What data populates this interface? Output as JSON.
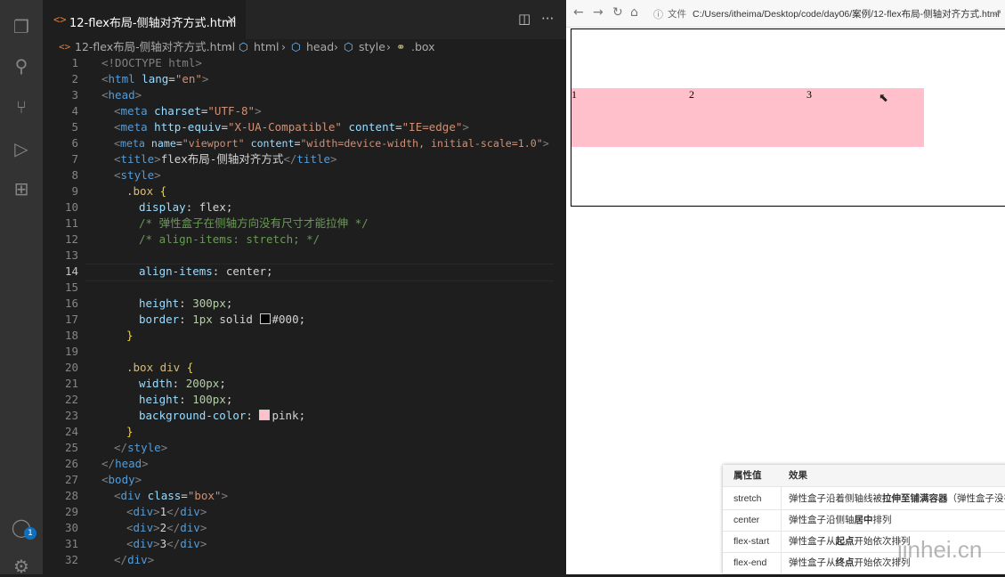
{
  "editor": {
    "tab": {
      "title": "12-flex布局-侧轴对齐方式.html",
      "close": "×"
    },
    "breadcrumb": [
      "12-flex布局-侧轴对齐方式.html",
      "html",
      "head",
      "style",
      ".box"
    ],
    "cursor_line": 14,
    "lines": [
      "1",
      "2",
      "3",
      "4",
      "5",
      "6",
      "7",
      "8",
      "9",
      "10",
      "11",
      "12",
      "13",
      "14",
      "15",
      "16",
      "17",
      "18",
      "19",
      "20",
      "21",
      "22",
      "23",
      "24",
      "25",
      "26",
      "27",
      "28",
      "29",
      "30",
      "31",
      "32"
    ],
    "code": {
      "l1": "<!DOCTYPE html>",
      "l2a": "html",
      "l2b": "lang",
      "l2c": "\"en\"",
      "l3": "head",
      "l4a": "meta",
      "l4b": "charset",
      "l4c": "\"UTF-8\"",
      "l5a": "meta",
      "l5b": "http-equiv",
      "l5c": "\"X-UA-Compatible\"",
      "l5d": "content",
      "l5e": "\"IE=edge\"",
      "l6a": "meta",
      "l6b": "name",
      "l6c": "\"viewport\"",
      "l6d": "content",
      "l6e": "\"width=device-width, initial-scale=1.0\"",
      "l7a": "title",
      "l7b": "flex布局-侧轴对齐方式",
      "l7c": "title",
      "l8": "style",
      "l9": ".box",
      "l10a": "display",
      "l10b": "flex",
      "l11": "/* 弹性盒子在侧轴方向没有尺寸才能拉伸 */",
      "l12": "/* align-items: stretch; */",
      "l14a": "align-items",
      "l14b": "center",
      "l16a": "height",
      "l16b": "300px",
      "l17a": "border",
      "l17b": "1px",
      "l17c": "solid",
      "l17d": "#000",
      "l20": ".box div",
      "l21a": "width",
      "l21b": "200px",
      "l22a": "height",
      "l22b": "100px",
      "l23a": "background-color",
      "l23b": "pink",
      "l25": "style",
      "l26": "head",
      "l27": "body",
      "l28a": "div",
      "l28b": "class",
      "l28c": "\"box\"",
      "l29a": "div",
      "l29b": "1",
      "l29c": "div",
      "l30a": "div",
      "l30b": "2",
      "l30c": "div",
      "l31a": "div",
      "l31b": "3",
      "l31c": "div",
      "l32": "div"
    },
    "notification_count": "1"
  },
  "browser": {
    "url_prefix": "文件",
    "url": "C:/Users/itheima/Desktop/code/day06/案例/12-flex布局-侧轴对齐方式.html",
    "items": [
      "1",
      "2",
      "3"
    ]
  },
  "table": {
    "headers": [
      "属性值",
      "效果"
    ],
    "rows": [
      {
        "value": "stretch",
        "effect_pre": "弹性盒子沿着侧轴线被",
        "effect_bold": "拉伸至铺满容器",
        "effect_post": "（弹性盒子没有"
      },
      {
        "value": "center",
        "effect_pre": "弹性盒子沿侧轴",
        "effect_bold": "居中",
        "effect_post": "排列"
      },
      {
        "value": "flex-start",
        "effect_pre": "弹性盒子从",
        "effect_bold": "起点",
        "effect_post": "开始依次排列"
      },
      {
        "value": "flex-end",
        "effect_pre": "弹性盒子从",
        "effect_bold": "终点",
        "effect_post": "开始依次排列"
      }
    ]
  },
  "watermark": "jinhei.cn",
  "colors": {
    "pink": "#ffc0cb",
    "editor_bg": "#1e1e1e",
    "activity_bar": "#333333"
  }
}
